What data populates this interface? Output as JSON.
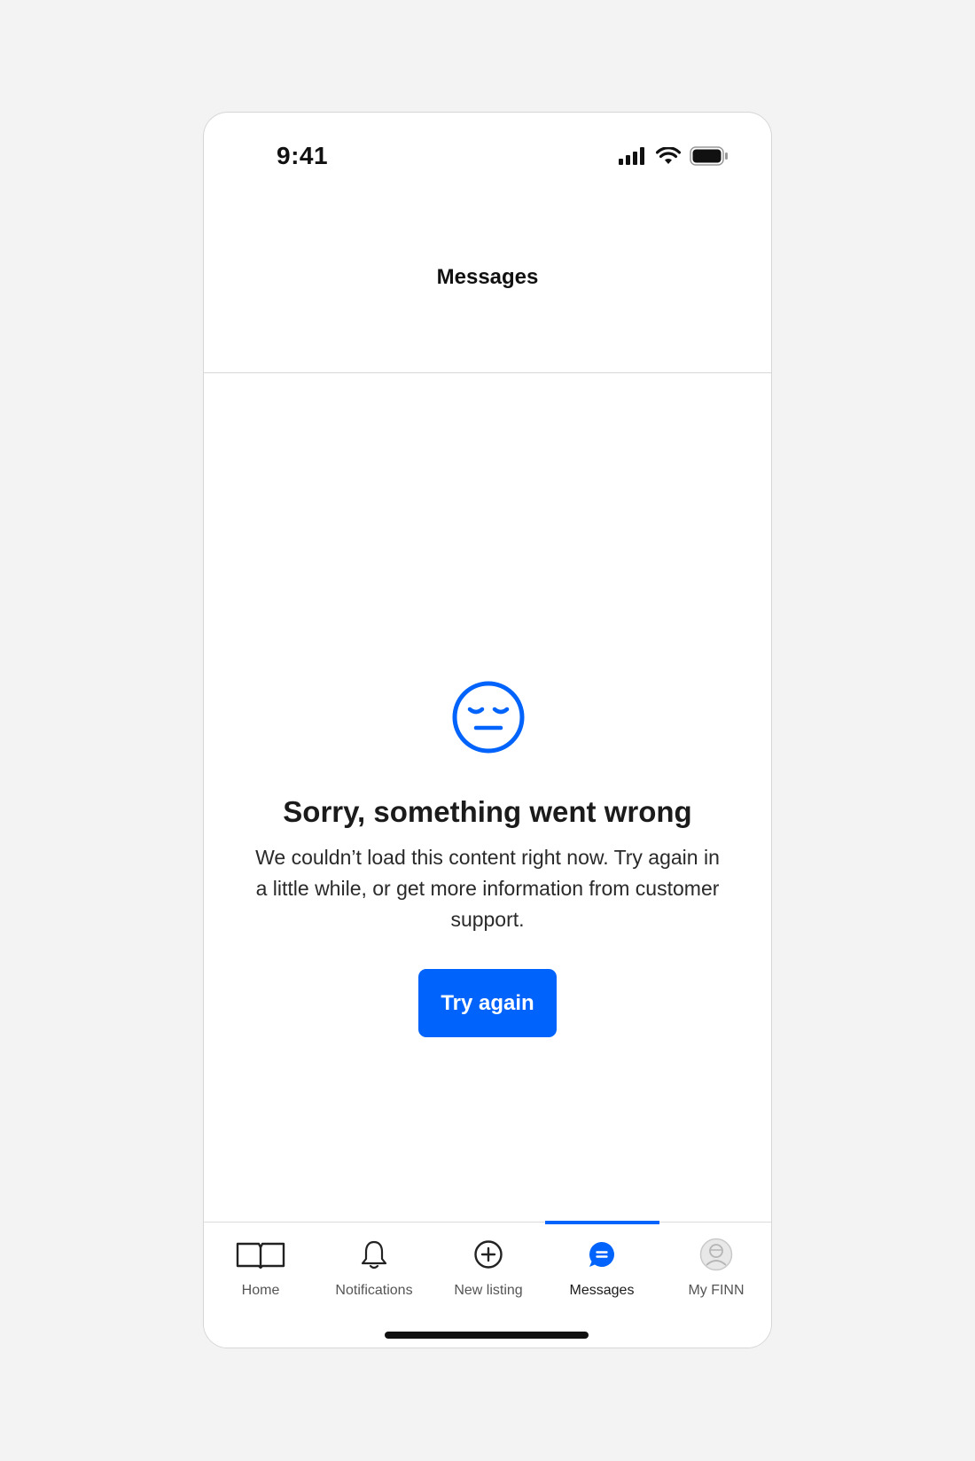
{
  "status_bar": {
    "time": "9:41"
  },
  "header": {
    "title": "Messages"
  },
  "error": {
    "icon": "sad-face-icon",
    "title": "Sorry, something went wrong",
    "message": "We couldn’t load this content right now. Try again in a little while, or get more information from customer support.",
    "button_label": "Try again"
  },
  "tab_bar": {
    "active": "Messages",
    "items": [
      {
        "label": "Home",
        "icon": "book-icon"
      },
      {
        "label": "Notifications",
        "icon": "bell-icon"
      },
      {
        "label": "New listing",
        "icon": "plus-circle-icon"
      },
      {
        "label": "Messages",
        "icon": "chat-bubble-icon"
      },
      {
        "label": "My FINN",
        "icon": "avatar-icon"
      }
    ]
  },
  "colors": {
    "accent": "#0063fb",
    "background": "#f3f3f3",
    "surface": "#ffffff",
    "text": "#1b1b1b"
  }
}
